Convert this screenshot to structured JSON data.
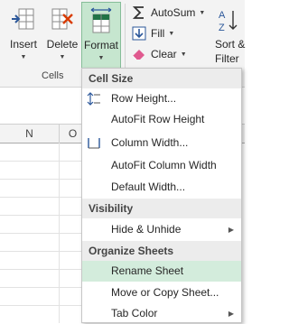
{
  "ribbon": {
    "insert_label": "Insert",
    "delete_label": "Delete",
    "format_label": "Format",
    "group_label": "Cells",
    "autosum_label": "AutoSum",
    "fill_label": "Fill",
    "clear_label": "Clear",
    "sort_label_line1": "Sort &",
    "sort_label_line2": "Filter",
    "accent_color": "#217346"
  },
  "sheet": {
    "columns": [
      "N",
      "O"
    ]
  },
  "menu": {
    "sections": [
      {
        "header": "Cell Size",
        "items": [
          {
            "text": "Row Height...",
            "icon": "row-height-icon",
            "submenu": false,
            "highlighted": false
          },
          {
            "text": "AutoFit Row Height",
            "icon": "",
            "submenu": false,
            "highlighted": false
          },
          {
            "text": "Column Width...",
            "icon": "column-width-icon",
            "submenu": false,
            "highlighted": false
          },
          {
            "text": "AutoFit Column Width",
            "icon": "",
            "submenu": false,
            "highlighted": false
          },
          {
            "text": "Default Width...",
            "icon": "",
            "submenu": false,
            "highlighted": false
          }
        ]
      },
      {
        "header": "Visibility",
        "items": [
          {
            "text": "Hide & Unhide",
            "icon": "",
            "submenu": true,
            "highlighted": false
          }
        ]
      },
      {
        "header": "Organize Sheets",
        "items": [
          {
            "text": "Rename Sheet",
            "icon": "",
            "submenu": false,
            "highlighted": true
          },
          {
            "text": "Move or Copy Sheet...",
            "icon": "",
            "submenu": false,
            "highlighted": false
          },
          {
            "text": "Tab Color",
            "icon": "",
            "submenu": true,
            "highlighted": false
          }
        ]
      }
    ]
  }
}
